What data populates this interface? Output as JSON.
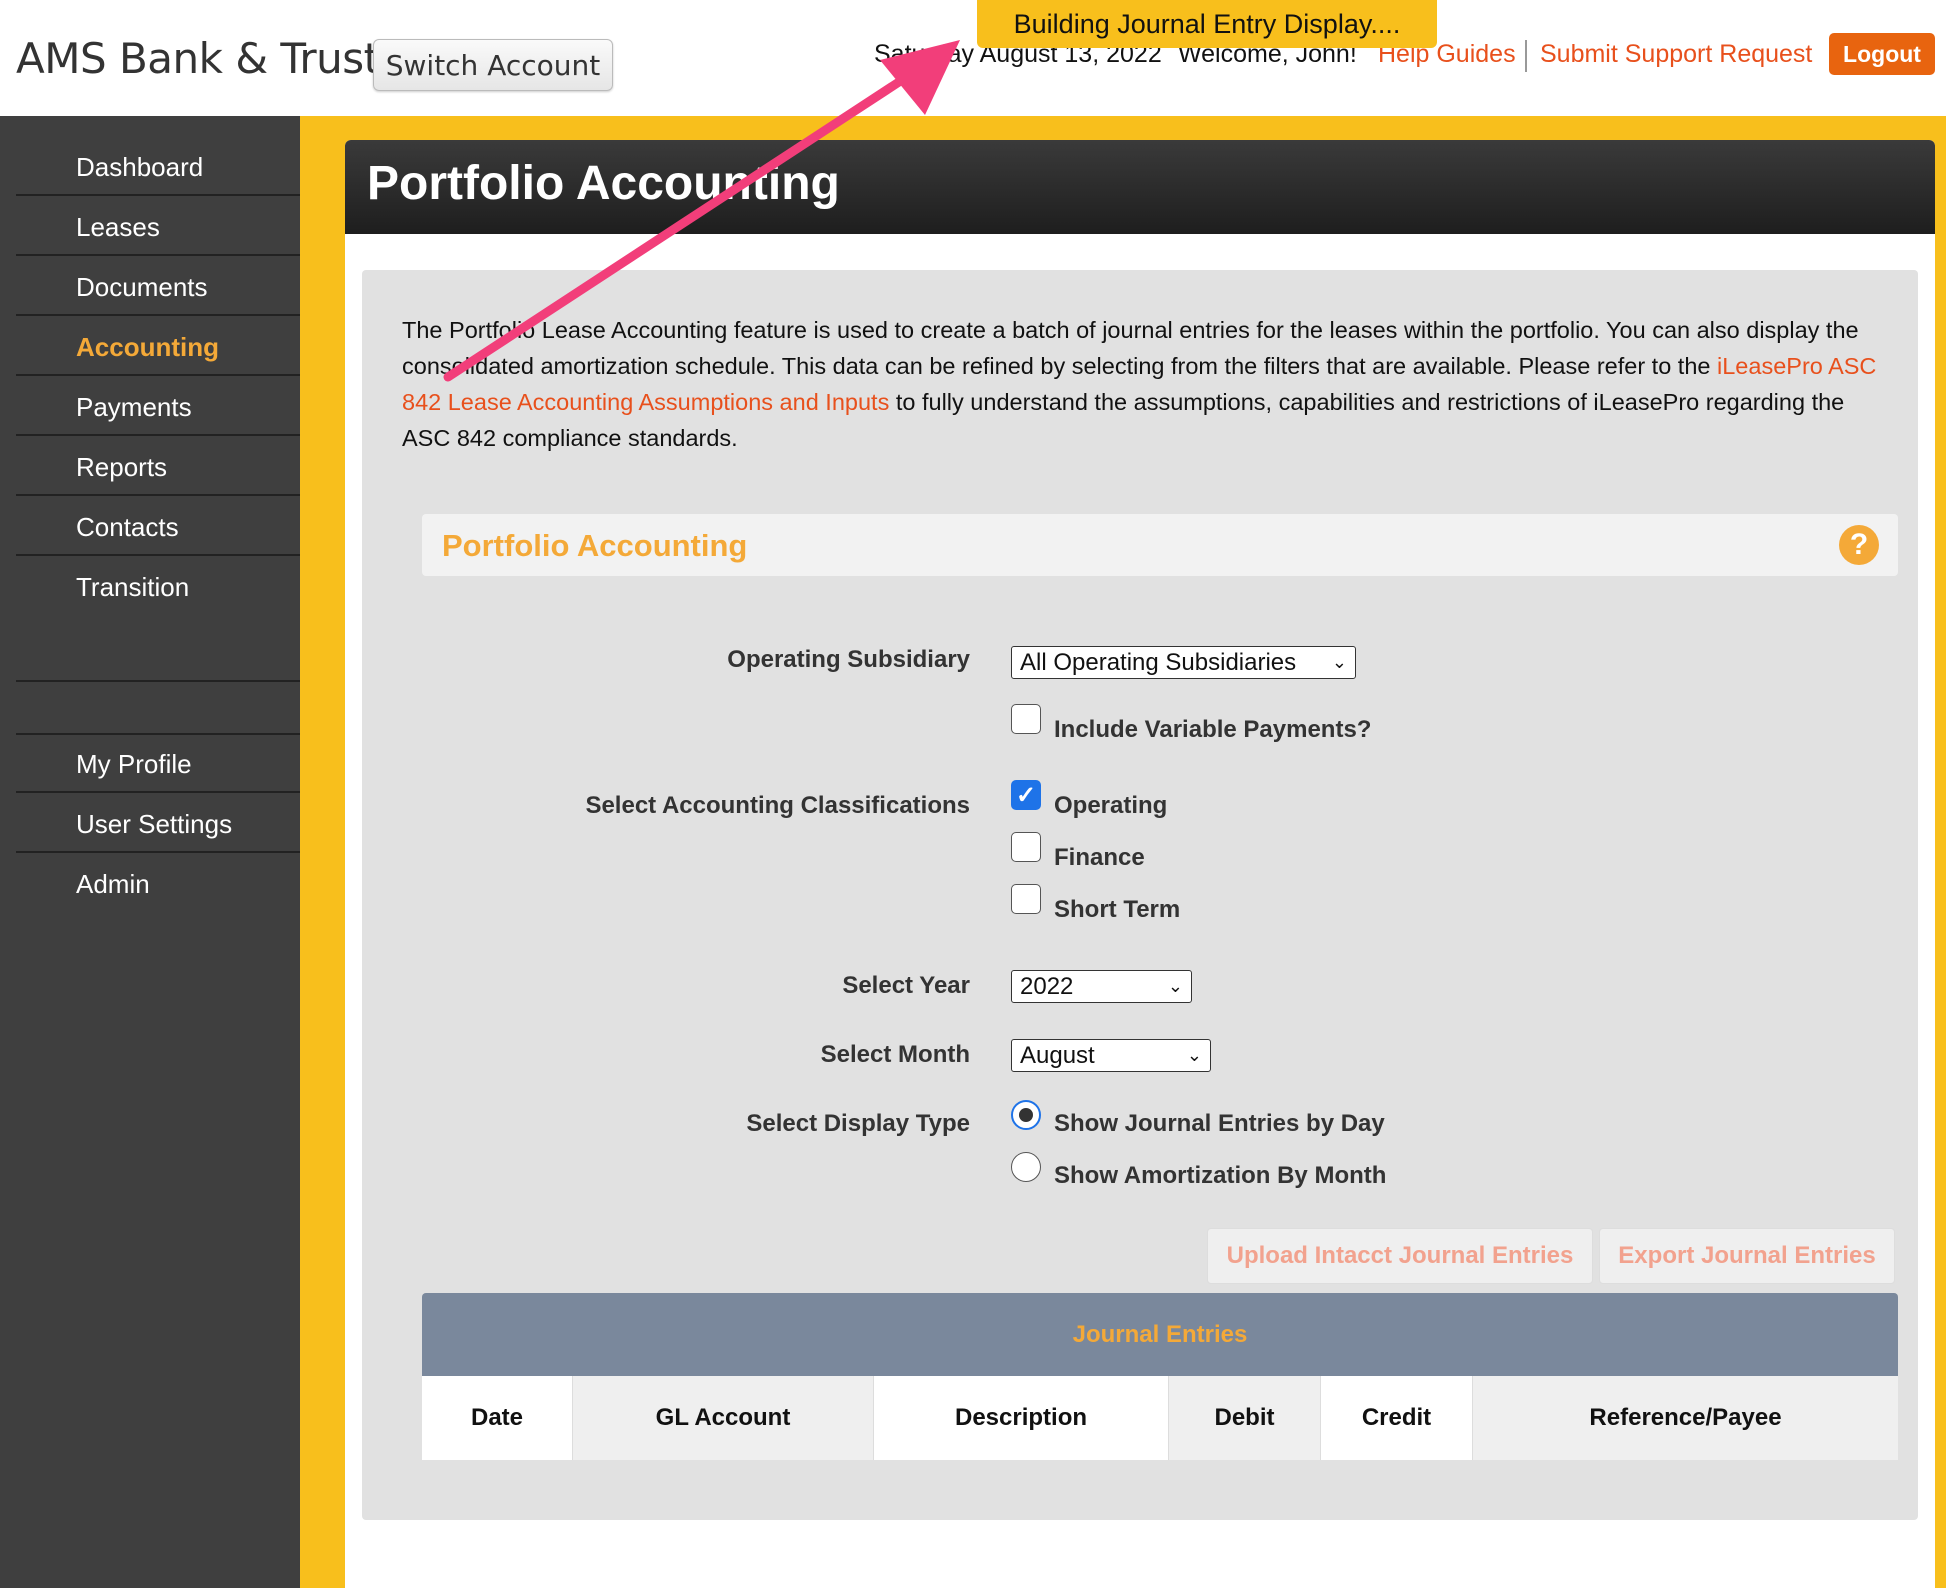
{
  "header": {
    "logo": "AMS Bank & Trust",
    "switch_account": "Switch Account",
    "date": "Saturday August 13, 2022",
    "welcome": "Welcome, John!",
    "help_guides": "Help Guides",
    "submit_support": "Submit Support Request",
    "logout": "Logout"
  },
  "toast": "Building Journal Entry Display....",
  "sidebar": {
    "items": [
      {
        "label": "Dashboard"
      },
      {
        "label": "Leases"
      },
      {
        "label": "Documents"
      },
      {
        "label": "Accounting"
      },
      {
        "label": "Payments"
      },
      {
        "label": "Reports"
      },
      {
        "label": "Contacts"
      },
      {
        "label": "Transition"
      }
    ],
    "bottom_items": [
      {
        "label": "My Profile"
      },
      {
        "label": "User Settings"
      },
      {
        "label": "Admin"
      }
    ],
    "active": "Accounting"
  },
  "page": {
    "title": "Portfolio Accounting",
    "intro_part1": "The Portfolio Lease Accounting feature is used to create a batch of journal entries for the leases within the portfolio. You can also display the consolidated amortization schedule. This data can be refined by selecting from the filters that are available. Please refer to the ",
    "intro_link": "iLeasePro ASC 842 Lease Accounting Assumptions and Inputs",
    "intro_part2": " to fully understand the assumptions, capabilities and restrictions of iLeasePro regarding the ASC 842 compliance standards.",
    "section_title": "Portfolio Accounting",
    "help": "?"
  },
  "form": {
    "operating_subsidiary_label": "Operating Subsidiary",
    "operating_subsidiary_value": "All Operating Subsidiaries",
    "include_variable_label": "Include Variable Payments?",
    "include_variable_checked": false,
    "classifications_label": "Select Accounting Classifications",
    "classifications": [
      {
        "label": "Operating",
        "checked": true
      },
      {
        "label": "Finance",
        "checked": false
      },
      {
        "label": "Short Term",
        "checked": false
      }
    ],
    "year_label": "Select Year",
    "year_value": "2022",
    "month_label": "Select Month",
    "month_value": "August",
    "display_type_label": "Select Display Type",
    "display_types": [
      {
        "label": "Show Journal Entries by Day",
        "selected": true
      },
      {
        "label": "Show Amortization By Month",
        "selected": false
      }
    ]
  },
  "buttons": {
    "upload_intacct": "Upload Intacct Journal Entries",
    "export": "Export Journal Entries"
  },
  "table": {
    "title": "Journal Entries",
    "columns": [
      "Date",
      "GL Account",
      "Description",
      "Debit",
      "Credit",
      "Reference/Payee"
    ]
  },
  "colors": {
    "accent_orange": "#f4a938",
    "link_orange": "#e8501c",
    "yellow_band": "#f8bf1c",
    "sidebar_bg": "#3f3f3f",
    "annotation_arrow": "#f23e7a"
  }
}
